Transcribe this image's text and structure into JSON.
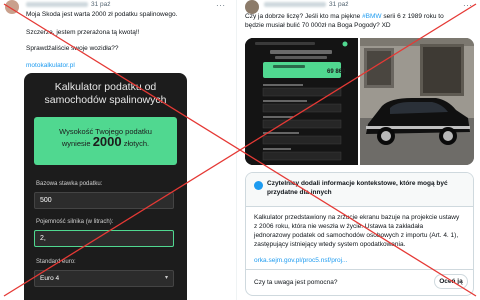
{
  "left_post": {
    "date": "31 paź",
    "lines": [
      "Moja Skoda jest warta 2000 zł podatku spalinowego.",
      "Szczerze, jestem przerażona tą kwotą!!",
      "Sprawdźaliście swoje wozidła??"
    ],
    "link_text": "motokalkulator.pl"
  },
  "calculator": {
    "title_line1": "Kalkulator podatku od",
    "title_line2": "samochodów spalinowych",
    "result_line1": "Wysokość Twojego podatku",
    "result_prefix": "wyniesie",
    "result_amount": "2000",
    "result_suffix": "złotych.",
    "field1_label": "Bazowa stawka podatku:",
    "field1_value": "500",
    "field2_label": "Pojemność silnika (w litrach):",
    "field2_value": "2,",
    "field3_label": "Standard euro:",
    "field3_value": "Euro 4"
  },
  "right_post": {
    "date": "31 paź",
    "line1_before": "Czy ja dobrze liczę? Jeśli kto ma piękne ",
    "line1_hashtag": "#BMW",
    "line1_after": " serii 6 z 1989 roku to",
    "line2": "będzie musiał bulić 70 000zł na Boga Pogody? XD",
    "screenshot_amount": "69 860"
  },
  "community_note": {
    "header_line1": "Czytelnicy dodali informacje kontekstowe, które mogą być",
    "header_line2": "przydatne dla innych",
    "body_lines": [
      "Kalkulator przedstawiony na zrzucie ekranu bazuje na projekcie ustawy",
      "z 2006 roku, która nie weszła w życie. Ustawa ta zakładała",
      "jednorazowy podatek od samochodów osobowych z importu (Art. 4. 1),",
      "zastępujący istniejący wtedy system opodatkowania."
    ],
    "link_text": "orka.sejm.gov.pl/proc5.nsf/proj...",
    "question": "Czy ta uwaga jest pomocna?",
    "rate_label": "Oceń ją"
  },
  "colors": {
    "cross": "#e53935",
    "link": "#1d9bf0",
    "calc_bg": "#1c1c1c",
    "calc_accent": "#50d890"
  }
}
